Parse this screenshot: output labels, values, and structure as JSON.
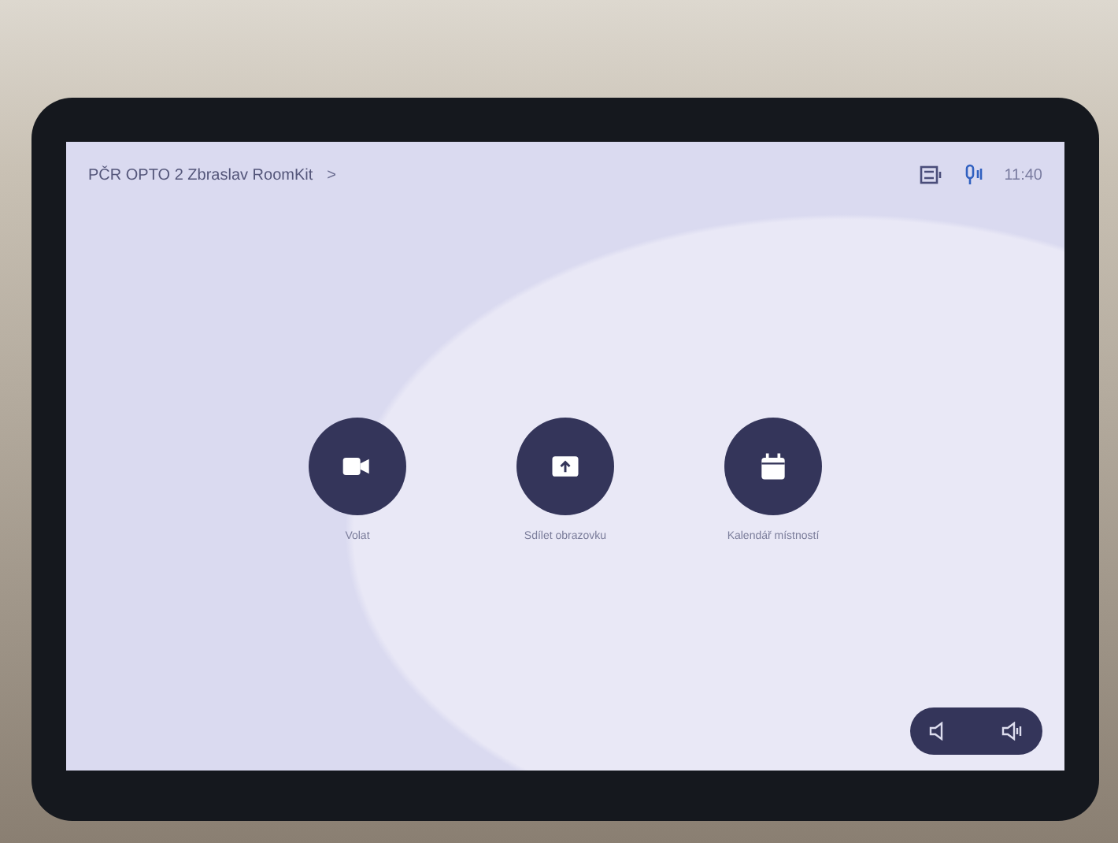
{
  "header": {
    "title": "PČR OPTO 2 Zbraslav RoomKit",
    "chevron": ">",
    "time": "11:40"
  },
  "actions": [
    {
      "kind": "call",
      "label": "Volat"
    },
    {
      "kind": "share",
      "label": "Sdílet obrazovku"
    },
    {
      "kind": "calendar",
      "label": "Kalendář místností"
    }
  ]
}
